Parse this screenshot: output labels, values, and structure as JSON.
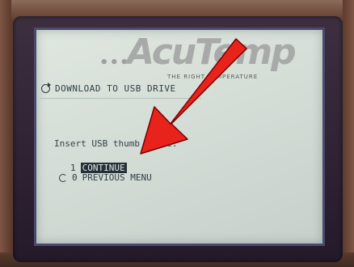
{
  "brand": {
    "dots": "•••",
    "name": "AcuTemp",
    "tagline": "THE RIGHT TEMPERATURE"
  },
  "screen": {
    "title": "DOWNLOAD TO USB DRIVE",
    "prompt": "Insert USB thumb drive."
  },
  "menu": {
    "items": [
      {
        "number": "1",
        "label": "CONTINUE",
        "selected": true
      },
      {
        "number": "0",
        "label": "PREVIOUS MENU",
        "selected": false
      }
    ]
  },
  "annotation": {
    "arrow_color": "#e8231c"
  }
}
